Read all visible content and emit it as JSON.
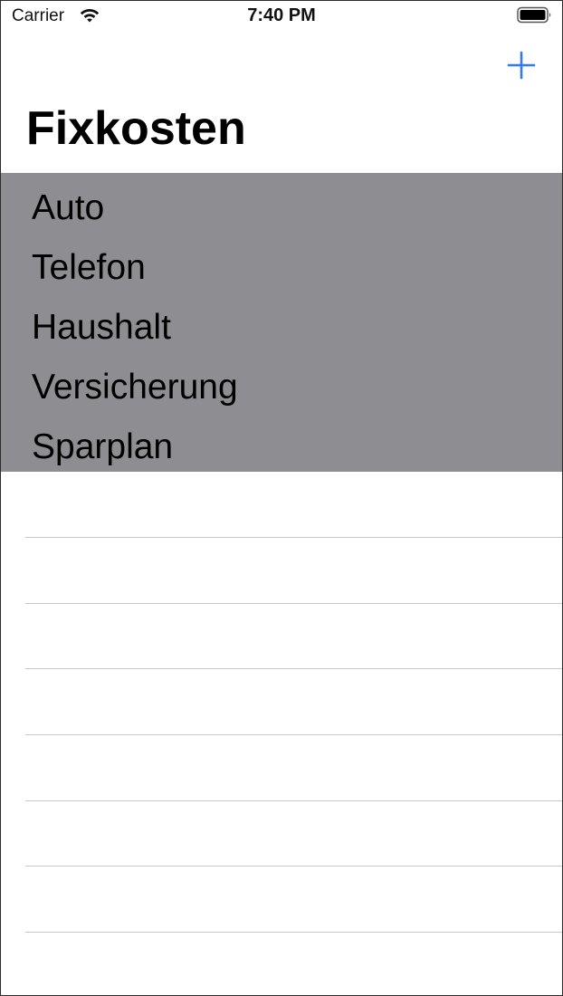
{
  "status_bar": {
    "carrier": "Carrier",
    "time": "7:40 PM",
    "wifi_icon": "wifi-icon",
    "battery_icon": "battery-full-icon"
  },
  "nav": {
    "add_icon": "plus-icon",
    "accent_color": "#3478f6",
    "title": "Fixkosten"
  },
  "list": {
    "highlight_color": "#8e8d92",
    "items": [
      {
        "label": "Auto"
      },
      {
        "label": "Telefon"
      },
      {
        "label": "Haushalt"
      },
      {
        "label": "Versicherung"
      },
      {
        "label": "Sparplan"
      }
    ]
  }
}
